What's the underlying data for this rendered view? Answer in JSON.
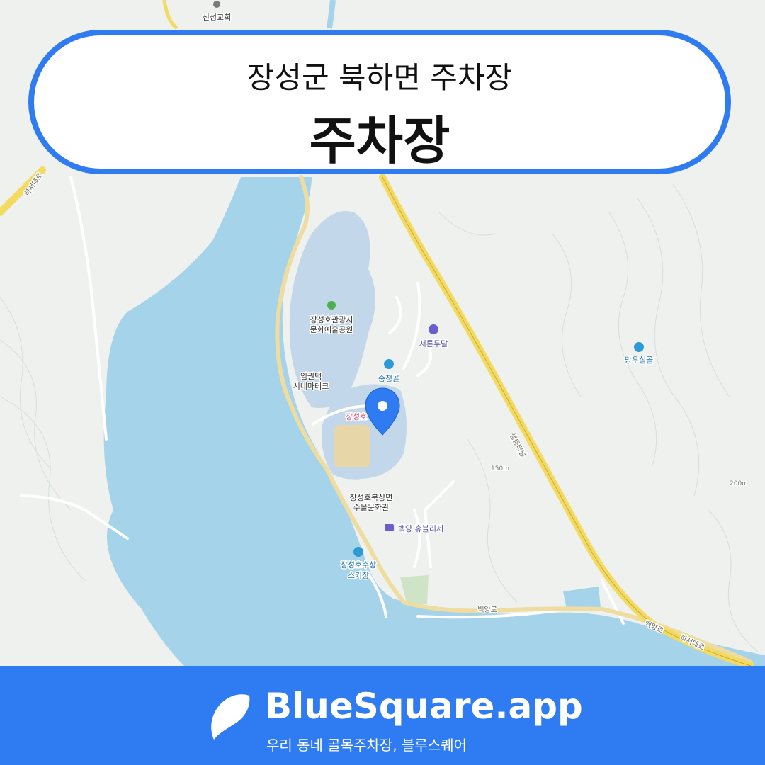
{
  "header": {
    "subtitle": "장성군 북하면 주차장",
    "title": "주차장"
  },
  "map": {
    "places": {
      "church": "신성교회",
      "park_line1": "장성호관광지",
      "park_line2": "문화예술공원",
      "cinema_line1": "임권택",
      "cinema_line2": "시네마테크",
      "seoreun": "서른두달",
      "songjeong": "송정골",
      "mangusil": "망우실골",
      "jangseongho": "장성호",
      "culture_line1": "장성호북상면",
      "culture_line2": "수몰문화관",
      "baekyang": "백양 휴블리제",
      "ski_line1": "장성호수상",
      "ski_line2": "스키장"
    },
    "roads": {
      "haseo_left": "하서대로",
      "tunnel": "생용터널",
      "baekyang_road": "백양로",
      "baekyang_right": "백양로",
      "haseo_right": "하서대로"
    },
    "elevations": {
      "e150": "150m",
      "e200": "200m"
    },
    "colors": {
      "water": "#a5d3ea",
      "land": "#eef1ee",
      "park": "#c3d7ea",
      "highway": "#f3da60",
      "marker": "#2f7bf1"
    }
  },
  "footer": {
    "brand": "BlueSquare.app",
    "tagline": "우리 동네 골목주차장, 블루스퀘어"
  }
}
